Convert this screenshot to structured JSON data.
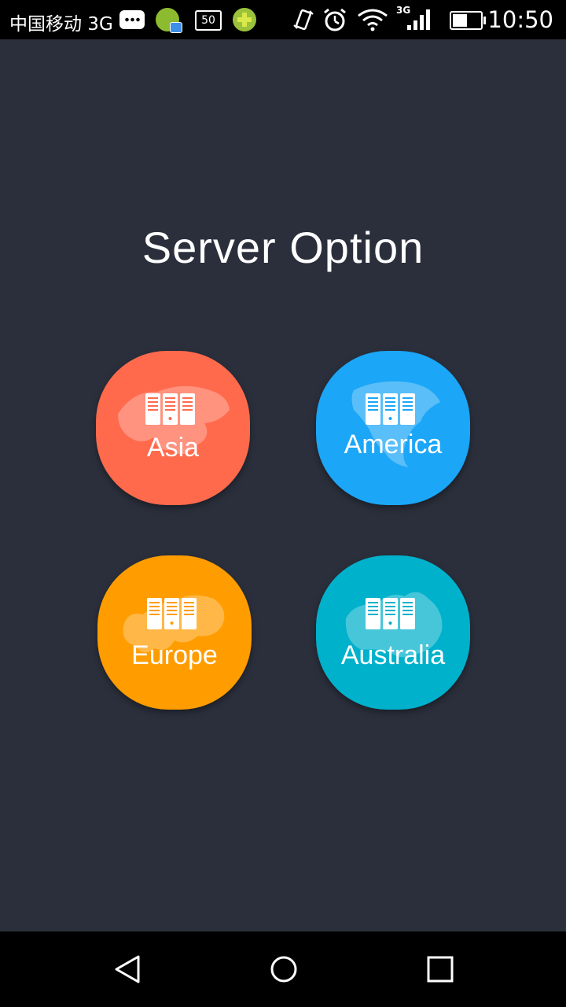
{
  "status_bar": {
    "carrier": "中国移动 3G",
    "badge_number": "50",
    "network_type": "3G",
    "time": "10:50",
    "icons": [
      "message-icon",
      "app-notification-icon",
      "sim-badge-icon",
      "app-plus-icon",
      "vibrate-icon",
      "alarm-icon",
      "wifi-icon",
      "signal-icon",
      "battery-icon"
    ]
  },
  "page": {
    "title": "Server Option"
  },
  "servers": [
    {
      "label": "Asia",
      "color": "#ff6a4d",
      "icon": "server-rack-icon"
    },
    {
      "label": "America",
      "color": "#1ba6f7",
      "icon": "server-rack-icon"
    },
    {
      "label": "Europe",
      "color": "#ff9d00",
      "icon": "server-rack-icon"
    },
    {
      "label": "Australia",
      "color": "#00b1cc",
      "icon": "server-rack-icon"
    }
  ],
  "nav_bar": {
    "icons": [
      "back-icon",
      "home-icon",
      "recents-icon"
    ]
  },
  "colors": {
    "background": "#2a2f3b",
    "bars": "#000000"
  }
}
